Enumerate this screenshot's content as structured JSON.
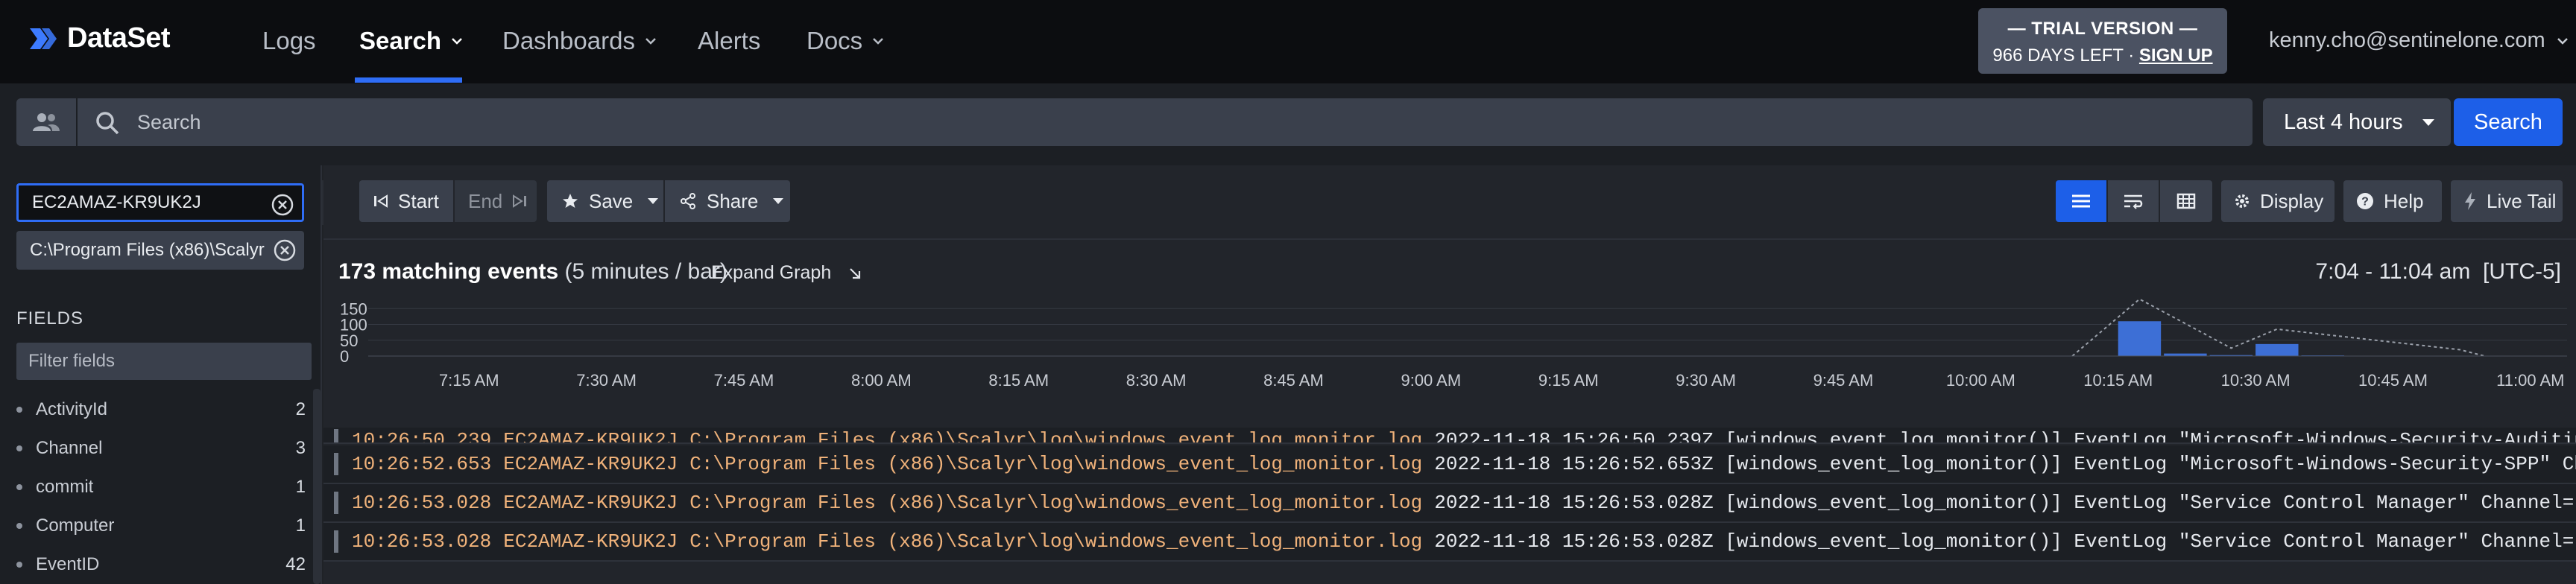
{
  "brand": {
    "name": "DataSet"
  },
  "nav": {
    "items": [
      {
        "label": "Logs"
      },
      {
        "label": "Search"
      },
      {
        "label": "Dashboards"
      },
      {
        "label": "Alerts"
      },
      {
        "label": "Docs"
      }
    ]
  },
  "trial": {
    "line1": "— TRIAL VERSION —",
    "days_left": "966 DAYS LEFT · ",
    "signup": "SIGN UP"
  },
  "user": {
    "email": "kenny.cho@sentinelone.com"
  },
  "search": {
    "placeholder": "Search",
    "value": "",
    "time_range": "Last 4 hours",
    "button": "Search"
  },
  "filters": {
    "active": [
      {
        "value": "EC2AMAZ-KR9UK2J"
      },
      {
        "value": "C:\\Program Files (x86)\\Scalyr"
      }
    ]
  },
  "fields": {
    "label": "FIELDS",
    "filter_placeholder": "Filter fields",
    "items": [
      {
        "name": "ActivityId",
        "count": "2"
      },
      {
        "name": "Channel",
        "count": "3"
      },
      {
        "name": "commit",
        "count": "1"
      },
      {
        "name": "Computer",
        "count": "1"
      },
      {
        "name": "EventID",
        "count": "42"
      }
    ]
  },
  "toolbar": {
    "start": "Start",
    "end": "End",
    "save": "Save",
    "share": "Share",
    "display": "Display",
    "help": "Help",
    "live_tail": "Live Tail"
  },
  "summary": {
    "count": "173 matching events",
    "bucket": "(5 minutes / bar)",
    "expand": "Expand Graph",
    "time_range": "7:04 - 11:04 am  [UTC-5]"
  },
  "colors": {
    "accent": "#1d5fe8",
    "bar": "#3d6fd6",
    "log_highlight": "#f0b27a"
  },
  "chart_data": {
    "type": "bar",
    "x": [
      "10:15 AM",
      "10:20 AM",
      "10:25 AM",
      "10:30 AM",
      "10:35 AM"
    ],
    "values": [
      110,
      8,
      3,
      38,
      2
    ],
    "overlay_line": [
      {
        "x": "10:15 AM",
        "y": 180
      },
      {
        "x": "10:25 AM",
        "y": 25
      },
      {
        "x": "10:30 AM",
        "y": 85
      },
      {
        "x": "10:50 AM",
        "y": 20
      }
    ],
    "yticks": [
      "150",
      "100",
      "50",
      "0"
    ],
    "ylim": [
      0,
      160
    ],
    "xticks": [
      "7:15 AM",
      "7:30 AM",
      "7:45 AM",
      "8:00 AM",
      "8:15 AM",
      "8:30 AM",
      "8:45 AM",
      "9:00 AM",
      "9:15 AM",
      "9:30 AM",
      "9:45 AM",
      "10:00 AM",
      "10:15 AM",
      "10:30 AM",
      "10:45 AM",
      "11:00 AM"
    ],
    "grid": true
  },
  "logs": {
    "rows": [
      {
        "ts": "10:26:52.653",
        "host": "EC2AMAZ-KR9UK2J",
        "file": "C:\\Program Files (x86)\\Scalyr\\log\\windows_event_log_monitor.log",
        "rest": "2022-11-18 15:26:52.653Z [windows_event_log_monitor()] EventLog \"Microsoft-Windows-Security-SPP\" Channel=\"Appli"
      },
      {
        "ts": "10:26:53.028",
        "host": "EC2AMAZ-KR9UK2J",
        "file": "C:\\Program Files (x86)\\Scalyr\\log\\windows_event_log_monitor.log",
        "rest": "2022-11-18 15:26:53.028Z [windows_event_log_monitor()] EventLog \"Service Control Manager\" Channel=\"System\" Compu"
      },
      {
        "ts": "10:26:53.028",
        "host": "EC2AMAZ-KR9UK2J",
        "file": "C:\\Program Files (x86)\\Scalyr\\log\\windows_event_log_monitor.log",
        "rest": "2022-11-18 15:26:53.028Z [windows_event_log_monitor()] EventLog \"Service Control Manager\" Channel=\"System\" Compu"
      }
    ],
    "partial_row": {
      "ts": "10:26:50.239",
      "host": "EC2AMAZ-KR9UK2J",
      "file": "C:\\Program Files (x86)\\Scalyr\\log\\windows_event_log_monitor.log",
      "rest": "2022-11-18 15:26:50.239Z [windows_event_log_monitor()] EventLog \"Microsoft-Windows-Security-Auditing\" Activity"
    }
  }
}
